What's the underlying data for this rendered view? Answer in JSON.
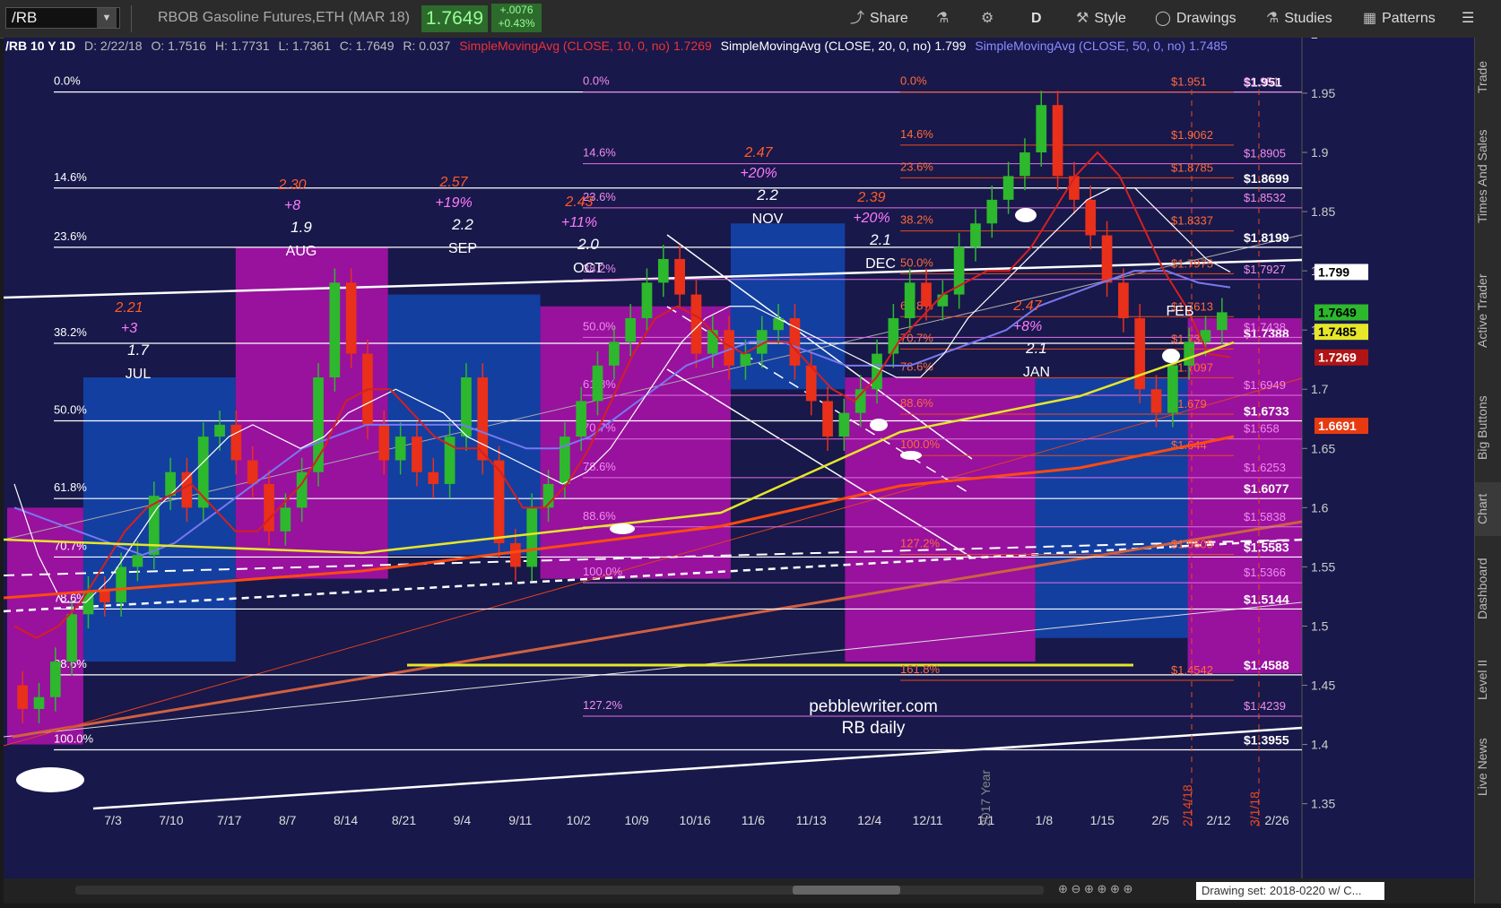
{
  "toolbar": {
    "symbol": "/RB",
    "instrument": "RBOB Gasoline Futures,ETH (MAR 18)",
    "last": "1.7649",
    "change": "+.0076",
    "change_pct": "+0.43%",
    "buttons": [
      {
        "label": "Share",
        "icon": "share-icon"
      },
      {
        "label": "",
        "icon": "flask-icon"
      },
      {
        "label": "",
        "icon": "gear-icon"
      },
      {
        "label": "D",
        "icon": ""
      },
      {
        "label": "Style",
        "icon": "style-icon"
      },
      {
        "label": "Drawings",
        "icon": "drawings-icon"
      },
      {
        "label": "Studies",
        "icon": "studies-icon"
      },
      {
        "label": "Patterns",
        "icon": "patterns-icon"
      }
    ]
  },
  "info": {
    "symbol": "/RB 10 Y 1D",
    "date": "D: 2/22/18",
    "open": "O: 1.7516",
    "high": "H: 1.7731",
    "low": "L: 1.7361",
    "close": "C: 1.7649",
    "range": "R: 0.037",
    "sma10": "SimpleMovingAvg (CLOSE, 10, 0, no)",
    "sma10_val": "1.7269",
    "sma20": "SimpleMovingAvg (CLOSE, 20, 0, no)",
    "sma20_val": "1.799",
    "sma50": "SimpleMovingAvg (CLOSE, 50, 0, no)",
    "sma50_val": "1.7485"
  },
  "right_tabs": [
    "Trade",
    "Times And Sales",
    "Active Trader",
    "Big Buttons",
    "Chart",
    "Dashboard",
    "Level II",
    "Live News"
  ],
  "bottom": {
    "drawing_set": "Drawing set: 2018-0220 w/ C..."
  },
  "colors": {
    "background": "#18184a",
    "up": "#2db82d",
    "down": "#e8301a",
    "magenta": "#a412a4",
    "blue": "#1443a8",
    "sma10": "#d42020",
    "sma20": "#ffffff",
    "sma50": "#7878f0",
    "yellow": "#e6e62a"
  },
  "chart_data": {
    "type": "candlestick",
    "title": "",
    "xlabel": "",
    "ylabel": "",
    "ylim": [
      1.33,
      2.0
    ],
    "yticks": [
      "1.35",
      "1.4",
      "1.45",
      "1.5",
      "1.55",
      "1.6",
      "1.65",
      "1.7",
      "1.75",
      "1.8",
      "1.85",
      "1.9",
      "1.95",
      "2"
    ],
    "xticks": [
      "7/3",
      "7/10",
      "7/17",
      "8/7",
      "8/14",
      "8/21",
      "9/4",
      "9/11",
      "10/2",
      "10/9",
      "10/16",
      "11/6",
      "11/13",
      "12/4",
      "12/11",
      "1/1",
      "1/8",
      "1/15",
      "2/5",
      "2/12",
      "2/26"
    ],
    "price_labels": [
      {
        "text": "1.799",
        "value": 1.799,
        "color": "#ffffff",
        "bg": "#ffffff",
        "fg": "#000000"
      },
      {
        "text": "1.7649",
        "value": 1.7649,
        "bg": "#2db82d",
        "fg": "#000000"
      },
      {
        "text": "1.7485",
        "value": 1.7485,
        "bg": "#e6e62a",
        "fg": "#000000"
      },
      {
        "text": "1.7269",
        "value": 1.7269,
        "bg": "#b01515",
        "fg": "#ffffff"
      },
      {
        "text": "1.6691",
        "value": 1.6691,
        "bg": "#e83a10",
        "fg": "#ffffff"
      }
    ],
    "fib_left": [
      {
        "pct": "0.0%",
        "value": 1.951
      },
      {
        "pct": "14.6%",
        "value": 1.8699
      },
      {
        "pct": "23.6%",
        "value": 1.8199
      },
      {
        "pct": "38.2%",
        "value": 1.7388
      },
      {
        "pct": "50.0%",
        "value": 1.6733
      },
      {
        "pct": "61.8%",
        "value": 1.6077
      },
      {
        "pct": "70.7%",
        "value": 1.5583
      },
      {
        "pct": "78.6%",
        "value": 1.5144
      },
      {
        "pct": "88.6%",
        "value": 1.4588
      },
      {
        "pct": "100.0%",
        "value": 1.3955
      }
    ],
    "fib_right_white": [
      "$1.951",
      "$1.8699",
      "$1.8199",
      "$1.7388",
      "$1.6733",
      "$1.6077",
      "$1.5583",
      "$1.5144",
      "$1.4588",
      "$1.3955"
    ],
    "fib_mid": [
      {
        "pct": "0.0%",
        "value": 1.951
      },
      {
        "pct": "14.6%",
        "value": 1.8905
      },
      {
        "pct": "23.6%",
        "value": 1.8532
      },
      {
        "pct": "38.2%",
        "value": 1.7927
      },
      {
        "pct": "50.0%",
        "value": 1.7438
      },
      {
        "pct": "61.8%",
        "value": 1.6949
      },
      {
        "pct": "70.7%",
        "value": 1.658
      },
      {
        "pct": "78.6%",
        "value": 1.6253
      },
      {
        "pct": "88.6%",
        "value": 1.5838
      },
      {
        "pct": "100.0%",
        "value": 1.5366
      },
      {
        "pct": "127.2%",
        "value": 1.4239
      }
    ],
    "fib_mid_labels": [
      "$1.951",
      "$1.8905",
      "$1.8532",
      "$1.7927",
      "$1.7438",
      "$1.6949",
      "$1.658",
      "$1.6253",
      "$1.5838",
      "$1.5366",
      "$1.4239"
    ],
    "fib_red": [
      {
        "pct": "0.0%",
        "value": 1.951
      },
      {
        "pct": "14.6%",
        "value": 1.9062
      },
      {
        "pct": "23.6%",
        "value": 1.8785
      },
      {
        "pct": "38.2%",
        "value": 1.8337
      },
      {
        "pct": "50.0%",
        "value": 1.7975
      },
      {
        "pct": "61.8%",
        "value": 1.7613
      },
      {
        "pct": "70.7%",
        "value": 1.734
      },
      {
        "pct": "78.6%",
        "value": 1.7097
      },
      {
        "pct": "88.6%",
        "value": 1.679
      },
      {
        "pct": "100.0%",
        "value": 1.644
      },
      {
        "pct": "127.2%",
        "value": 1.5605
      },
      {
        "pct": "161.8%",
        "value": 1.4542
      }
    ],
    "fib_red_labels": [
      "$1.951",
      "$1.9062",
      "$1.8785",
      "$1.8337",
      "$1.7975",
      "$1.7613",
      "$1.734",
      "$1.7097",
      "$1.679",
      "$1.644",
      "$1.5605",
      "$1.4542"
    ],
    "seasonal": [
      {
        "month": "JUL",
        "avg": "1.7",
        "top": "2.21",
        "pct": "+3"
      },
      {
        "month": "AUG",
        "avg": "1.9",
        "top": "2.30",
        "pct": "+8"
      },
      {
        "month": "SEP",
        "avg": "2.2",
        "top": "2.57",
        "pct": "+19%"
      },
      {
        "month": "OCT",
        "avg": "2.0",
        "top": "2.43",
        "pct": "+11%"
      },
      {
        "month": "NOV",
        "avg": "2.2",
        "top": "2.47",
        "pct": "+20%"
      },
      {
        "month": "DEC",
        "avg": "2.1",
        "top": "2.39",
        "pct": "+20%"
      },
      {
        "month": "JAN",
        "avg": "2.1",
        "top": "2.47",
        "pct": "+8%"
      },
      {
        "month": "FEB",
        "avg": "",
        "top": "",
        "pct": ""
      }
    ],
    "annotations": [
      "pebblewriter.com",
      "RB daily",
      "2017 Year",
      "2/14/18",
      "3/1/18"
    ],
    "boxes": [
      {
        "color": "magenta",
        "x0": 0,
        "x1": 2,
        "y0": 1.6,
        "y1": 1.4
      },
      {
        "color": "blue",
        "x0": 2,
        "x1": 6,
        "y0": 1.71,
        "y1": 1.47
      },
      {
        "color": "magenta",
        "x0": 6,
        "x1": 10,
        "y0": 1.82,
        "y1": 1.54
      },
      {
        "color": "blue",
        "x0": 10,
        "x1": 14,
        "y0": 1.78,
        "y1": 1.56
      },
      {
        "color": "magenta",
        "x0": 14,
        "x1": 19,
        "y0": 1.77,
        "y1": 1.54
      },
      {
        "color": "blue",
        "x0": 19,
        "x1": 22,
        "y0": 1.84,
        "y1": 1.7
      },
      {
        "color": "magenta",
        "x0": 22,
        "x1": 27,
        "y0": 1.71,
        "y1": 1.47
      },
      {
        "color": "blue",
        "x0": 27,
        "x1": 31,
        "y0": 1.71,
        "y1": 1.49
      },
      {
        "color": "magenta",
        "x0": 31,
        "x1": 34,
        "y0": 1.76,
        "y1": 1.46
      }
    ],
    "candles": [
      [
        1.45,
        1.43
      ],
      [
        1.43,
        1.44
      ],
      [
        1.44,
        1.47
      ],
      [
        1.47,
        1.51
      ],
      [
        1.51,
        1.53
      ],
      [
        1.53,
        1.52
      ],
      [
        1.52,
        1.55
      ],
      [
        1.55,
        1.56
      ],
      [
        1.56,
        1.61
      ],
      [
        1.61,
        1.63
      ],
      [
        1.63,
        1.6
      ],
      [
        1.6,
        1.66
      ],
      [
        1.66,
        1.67
      ],
      [
        1.67,
        1.64
      ],
      [
        1.64,
        1.62
      ],
      [
        1.62,
        1.58
      ],
      [
        1.58,
        1.6
      ],
      [
        1.6,
        1.63
      ],
      [
        1.63,
        1.71
      ],
      [
        1.71,
        1.79
      ],
      [
        1.79,
        1.73
      ],
      [
        1.73,
        1.67
      ],
      [
        1.67,
        1.64
      ],
      [
        1.64,
        1.66
      ],
      [
        1.66,
        1.63
      ],
      [
        1.63,
        1.62
      ],
      [
        1.62,
        1.66
      ],
      [
        1.66,
        1.71
      ],
      [
        1.71,
        1.64
      ],
      [
        1.64,
        1.57
      ],
      [
        1.57,
        1.55
      ],
      [
        1.55,
        1.6
      ],
      [
        1.6,
        1.62
      ],
      [
        1.62,
        1.66
      ],
      [
        1.66,
        1.69
      ],
      [
        1.69,
        1.72
      ],
      [
        1.72,
        1.74
      ],
      [
        1.74,
        1.76
      ],
      [
        1.76,
        1.79
      ],
      [
        1.79,
        1.81
      ],
      [
        1.81,
        1.78
      ],
      [
        1.78,
        1.73
      ],
      [
        1.73,
        1.75
      ],
      [
        1.75,
        1.72
      ],
      [
        1.72,
        1.73
      ],
      [
        1.73,
        1.75
      ],
      [
        1.75,
        1.76
      ],
      [
        1.76,
        1.72
      ],
      [
        1.72,
        1.69
      ],
      [
        1.69,
        1.66
      ],
      [
        1.66,
        1.68
      ],
      [
        1.68,
        1.7
      ],
      [
        1.7,
        1.73
      ],
      [
        1.73,
        1.76
      ],
      [
        1.76,
        1.79
      ],
      [
        1.79,
        1.77
      ],
      [
        1.77,
        1.78
      ],
      [
        1.78,
        1.82
      ],
      [
        1.82,
        1.84
      ],
      [
        1.84,
        1.86
      ],
      [
        1.86,
        1.88
      ],
      [
        1.88,
        1.9
      ],
      [
        1.9,
        1.94
      ],
      [
        1.94,
        1.88
      ],
      [
        1.88,
        1.86
      ],
      [
        1.86,
        1.83
      ],
      [
        1.83,
        1.79
      ],
      [
        1.79,
        1.76
      ],
      [
        1.76,
        1.7
      ],
      [
        1.7,
        1.68
      ],
      [
        1.68,
        1.72
      ],
      [
        1.72,
        1.74
      ],
      [
        1.74,
        1.75
      ],
      [
        1.75,
        1.765
      ]
    ],
    "sma10": [
      1.5,
      1.49,
      1.5,
      1.52,
      1.55,
      1.58,
      1.6,
      1.61,
      1.62,
      1.6,
      1.58,
      1.58,
      1.6,
      1.62,
      1.65,
      1.69,
      1.7,
      1.7,
      1.68,
      1.66,
      1.65,
      1.65,
      1.63,
      1.6,
      1.6,
      1.62,
      1.65,
      1.69,
      1.73,
      1.76,
      1.77,
      1.76,
      1.74,
      1.73,
      1.74,
      1.74,
      1.72,
      1.7,
      1.69,
      1.71,
      1.74,
      1.76,
      1.78,
      1.79,
      1.8,
      1.8,
      1.82,
      1.85,
      1.88,
      1.9,
      1.88,
      1.84,
      1.8,
      1.77,
      1.73,
      1.727
    ],
    "sma20": [
      1.62,
      1.56,
      1.52,
      1.52,
      1.54,
      1.57,
      1.6,
      1.62,
      1.64,
      1.66,
      1.67,
      1.66,
      1.65,
      1.66,
      1.68,
      1.69,
      1.7,
      1.69,
      1.68,
      1.66,
      1.65,
      1.64,
      1.63,
      1.62,
      1.63,
      1.65,
      1.68,
      1.71,
      1.74,
      1.76,
      1.77,
      1.77,
      1.76,
      1.75,
      1.74,
      1.73,
      1.72,
      1.71,
      1.71,
      1.73,
      1.76,
      1.78,
      1.8,
      1.82,
      1.84,
      1.86,
      1.87,
      1.87,
      1.85,
      1.83,
      1.81,
      1.799
    ],
    "sma50": [
      1.6,
      1.59,
      1.58,
      1.57,
      1.56,
      1.57,
      1.59,
      1.61,
      1.63,
      1.65,
      1.66,
      1.67,
      1.67,
      1.67,
      1.67,
      1.66,
      1.65,
      1.65,
      1.66,
      1.68,
      1.7,
      1.72,
      1.73,
      1.74,
      1.74,
      1.73,
      1.72,
      1.72,
      1.72,
      1.73,
      1.74,
      1.75,
      1.77,
      1.78,
      1.79,
      1.8,
      1.8,
      1.79,
      1.786
    ]
  }
}
